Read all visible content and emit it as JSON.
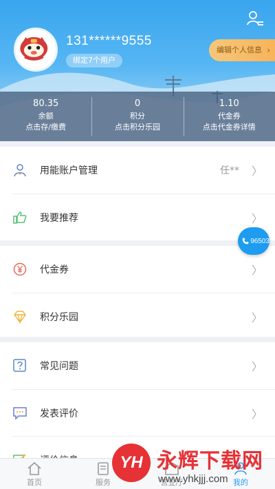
{
  "header": {
    "phone": "131******9555",
    "bind_badge": "绑定7个用户",
    "edit_label": "编辑个人信息",
    "edit_chevron": "›"
  },
  "stats": [
    {
      "value": "80.35",
      "label": "余额",
      "action": "点击存/缴费"
    },
    {
      "value": "0",
      "label": "积分",
      "action": "点击积分乐园"
    },
    {
      "value": "1.10",
      "label": "代金券",
      "action": "点击代金券详情"
    }
  ],
  "sections": {
    "account": [
      {
        "label": "用能账户管理",
        "extra": "任**",
        "icon": "user-account-icon"
      },
      {
        "label": "我要推荐",
        "icon": "thumbs-up-icon"
      }
    ],
    "rewards": [
      {
        "label": "代金券",
        "icon": "yen-coupon-icon"
      },
      {
        "label": "积分乐园",
        "icon": "diamond-icon"
      }
    ],
    "support": [
      {
        "label": "常见问题",
        "icon": "question-icon"
      },
      {
        "label": "发表评价",
        "icon": "comment-icon"
      },
      {
        "label": "评价信息",
        "icon": "edit-icon"
      }
    ]
  },
  "float_call": {
    "number": "96503"
  },
  "tabbar": [
    {
      "label": "首页",
      "icon": "home-icon"
    },
    {
      "label": "服务",
      "icon": "service-icon"
    },
    {
      "label": "营业厅",
      "icon": "hall-icon"
    },
    {
      "label": "我的",
      "icon": "profile-icon",
      "active": true
    }
  ],
  "watermark": {
    "logo": "YH",
    "title": "永辉下载网",
    "url": "www.yhkjjj.com"
  },
  "colors": {
    "accent": "#2b9cf2",
    "header_top": "#39a5ee",
    "edit_button": "#f7b35a",
    "watermark": "#e63135"
  }
}
